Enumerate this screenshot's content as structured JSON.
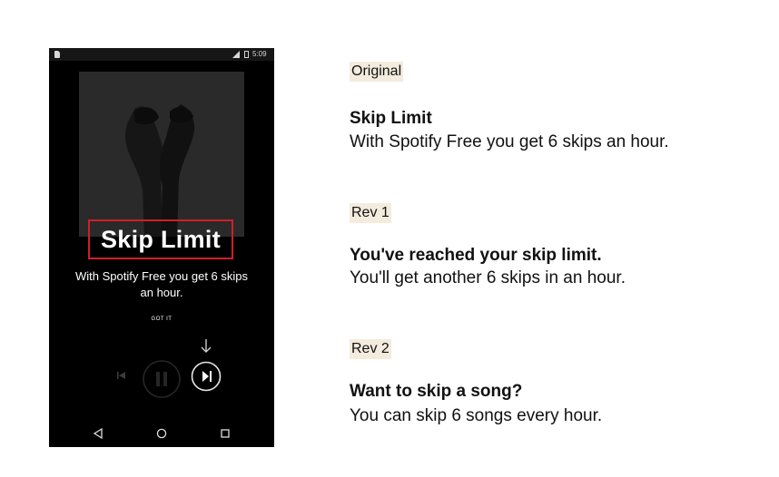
{
  "phone": {
    "status_time": "5:09",
    "title": "Skip Limit",
    "subtitle": "With Spotify Free you get 6 skips an hour.",
    "got_it": "GOT IT"
  },
  "colors": {
    "highlight": "#f3ebdd",
    "callout_border": "#d11f26",
    "phone_bg": "#000000"
  },
  "icons": [
    "sd-card-icon",
    "signal-icon",
    "battery-icon",
    "down-arrow-icon",
    "previous-icon",
    "pause-icon",
    "next-icon",
    "back-nav-icon",
    "home-nav-icon",
    "recents-nav-icon"
  ],
  "versions": [
    {
      "label": "Original",
      "title": "Skip Limit",
      "body": "With Spotify Free you get 6 skips an hour."
    },
    {
      "label": "Rev 1",
      "title": "You've reached your skip limit.",
      "body": "You'll get another 6 skips in an hour."
    },
    {
      "label": "Rev 2",
      "title": "Want to skip a song?",
      "body": "You can skip 6 songs every hour."
    }
  ]
}
